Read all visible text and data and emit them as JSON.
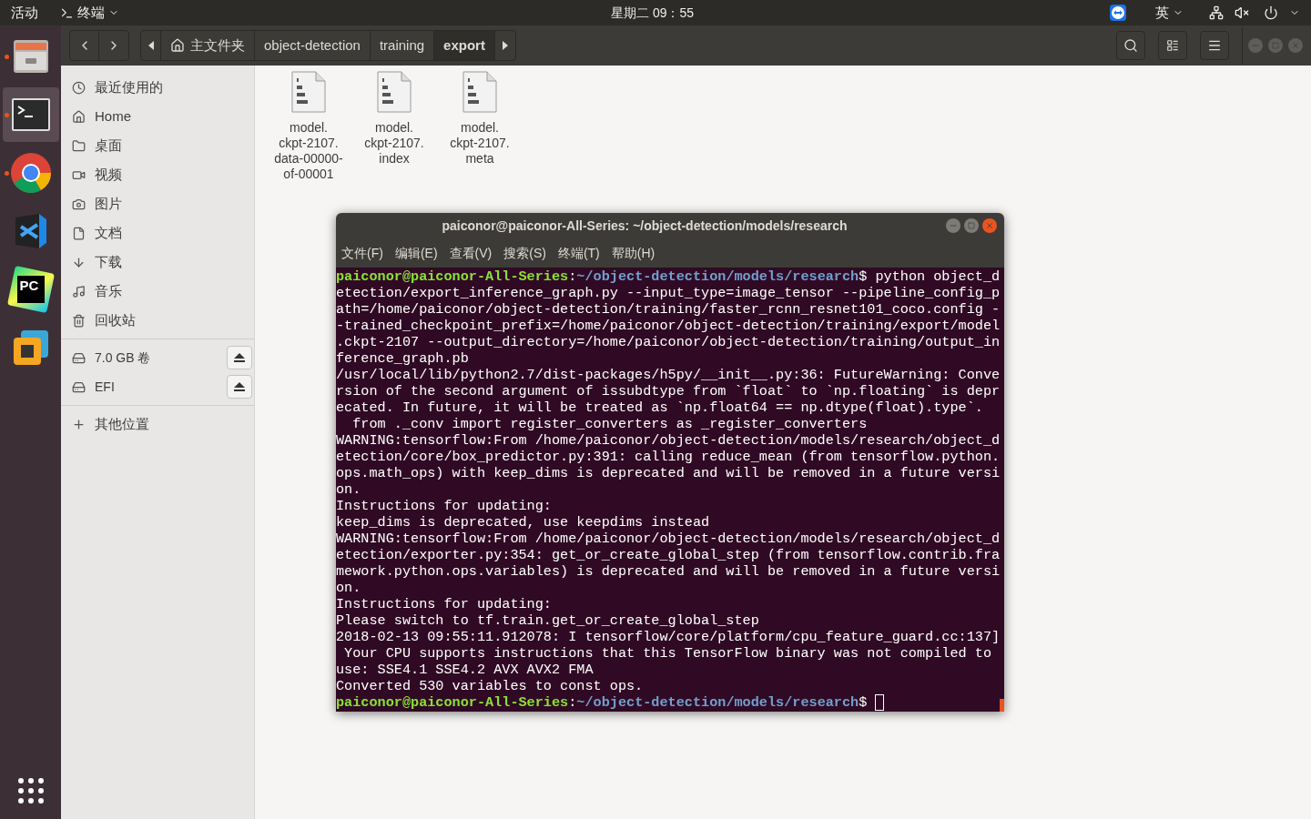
{
  "top_bar": {
    "activities": "活动",
    "app_menu": "终端",
    "clock": "星期二 09：55",
    "input_method": "英"
  },
  "dock": [
    {
      "kind": "files",
      "running": true,
      "selected": false
    },
    {
      "kind": "terminal",
      "running": true,
      "selected": true
    },
    {
      "kind": "browser",
      "running": true,
      "selected": false
    },
    {
      "kind": "code",
      "running": false,
      "selected": false
    },
    {
      "kind": "pycharm",
      "running": false,
      "selected": false,
      "logo_text": "PC"
    },
    {
      "kind": "vm",
      "running": false,
      "selected": false
    }
  ],
  "path_bar": [
    {
      "label": "主文件夹",
      "kind": "home",
      "selected": false
    },
    {
      "label": "object-detection",
      "kind": "folder",
      "selected": false
    },
    {
      "label": "training",
      "kind": "folder",
      "selected": false
    },
    {
      "label": "export",
      "kind": "folder",
      "selected": true
    }
  ],
  "sidebar": {
    "places": [
      {
        "kind": "recent",
        "label": "最近使用的"
      },
      {
        "kind": "home",
        "label": "Home"
      },
      {
        "kind": "desktop",
        "label": "桌面"
      },
      {
        "kind": "videos",
        "label": "视频"
      },
      {
        "kind": "pictures",
        "label": "图片"
      },
      {
        "kind": "documents",
        "label": "文档"
      },
      {
        "kind": "downloads",
        "label": "下载"
      },
      {
        "kind": "music",
        "label": "音乐"
      },
      {
        "kind": "trash",
        "label": "回收站"
      }
    ],
    "devices": [
      {
        "label": "7.0 GB 卷"
      },
      {
        "label": "EFI"
      }
    ],
    "other": "其他位置"
  },
  "files": [
    {
      "name": [
        "model.",
        "ckpt-2107.",
        "data-00000-",
        "of-00001"
      ]
    },
    {
      "name": [
        "model.",
        "ckpt-2107.",
        "index"
      ]
    },
    {
      "name": [
        "model.",
        "ckpt-2107.",
        "meta"
      ]
    }
  ],
  "terminal": {
    "title": "paiconor@paiconor-All-Series: ~/object-detection/models/research",
    "menu": [
      "文件(F)",
      "编辑(E)",
      "查看(V)",
      "搜索(S)",
      "终端(T)",
      "帮助(H)"
    ],
    "lines": [
      {
        "kind": "prompt",
        "user": "paiconor@paiconor-All-Series",
        "sep": ":",
        "path": "~/object-detection/models/research",
        "command": "$ python object_d",
        "cursor": false
      },
      {
        "kind": "output",
        "text": "etection/export_inference_graph.py --input_type=image_tensor --pipeline_config_p"
      },
      {
        "kind": "output",
        "text": "ath=/home/paiconor/object-detection/training/faster_rcnn_resnet101_coco.config -"
      },
      {
        "kind": "output",
        "text": "-trained_checkpoint_prefix=/home/paiconor/object-detection/training/export/model"
      },
      {
        "kind": "output",
        "text": ".ckpt-2107 --output_directory=/home/paiconor/object-detection/training/output_in"
      },
      {
        "kind": "output",
        "text": "ference_graph.pb"
      },
      {
        "kind": "output",
        "text": "/usr/local/lib/python2.7/dist-packages/h5py/__init__.py:36: FutureWarning: Conve"
      },
      {
        "kind": "output",
        "text": "rsion of the second argument of issubdtype from `float` to `np.floating` is depr"
      },
      {
        "kind": "output",
        "text": "ecated. In future, it will be treated as `np.float64 == np.dtype(float).type`."
      },
      {
        "kind": "output",
        "text": "  from ._conv import register_converters as _register_converters"
      },
      {
        "kind": "output",
        "text": "WARNING:tensorflow:From /home/paiconor/object-detection/models/research/object_d"
      },
      {
        "kind": "output",
        "text": "etection/core/box_predictor.py:391: calling reduce_mean (from tensorflow.python."
      },
      {
        "kind": "output",
        "text": "ops.math_ops) with keep_dims is deprecated and will be removed in a future versi"
      },
      {
        "kind": "output",
        "text": "on."
      },
      {
        "kind": "output",
        "text": "Instructions for updating:"
      },
      {
        "kind": "output",
        "text": "keep_dims is deprecated, use keepdims instead"
      },
      {
        "kind": "output",
        "text": "WARNING:tensorflow:From /home/paiconor/object-detection/models/research/object_d"
      },
      {
        "kind": "output",
        "text": "etection/exporter.py:354: get_or_create_global_step (from tensorflow.contrib.fra"
      },
      {
        "kind": "output",
        "text": "mework.python.ops.variables) is deprecated and will be removed in a future versi"
      },
      {
        "kind": "output",
        "text": "on."
      },
      {
        "kind": "output",
        "text": "Instructions for updating:"
      },
      {
        "kind": "output",
        "text": "Please switch to tf.train.get_or_create_global_step"
      },
      {
        "kind": "output",
        "text": "2018-02-13 09:55:11.912078: I tensorflow/core/platform/cpu_feature_guard.cc:137]"
      },
      {
        "kind": "output",
        "text": " Your CPU supports instructions that this TensorFlow binary was not compiled to"
      },
      {
        "kind": "output",
        "text": "use: SSE4.1 SSE4.2 AVX AVX2 FMA"
      },
      {
        "kind": "output",
        "text": "Converted 530 variables to const ops."
      },
      {
        "kind": "prompt",
        "user": "paiconor@paiconor-All-Series",
        "sep": ":",
        "path": "~/object-detection/models/research",
        "command": "$ ",
        "cursor": true
      }
    ]
  }
}
